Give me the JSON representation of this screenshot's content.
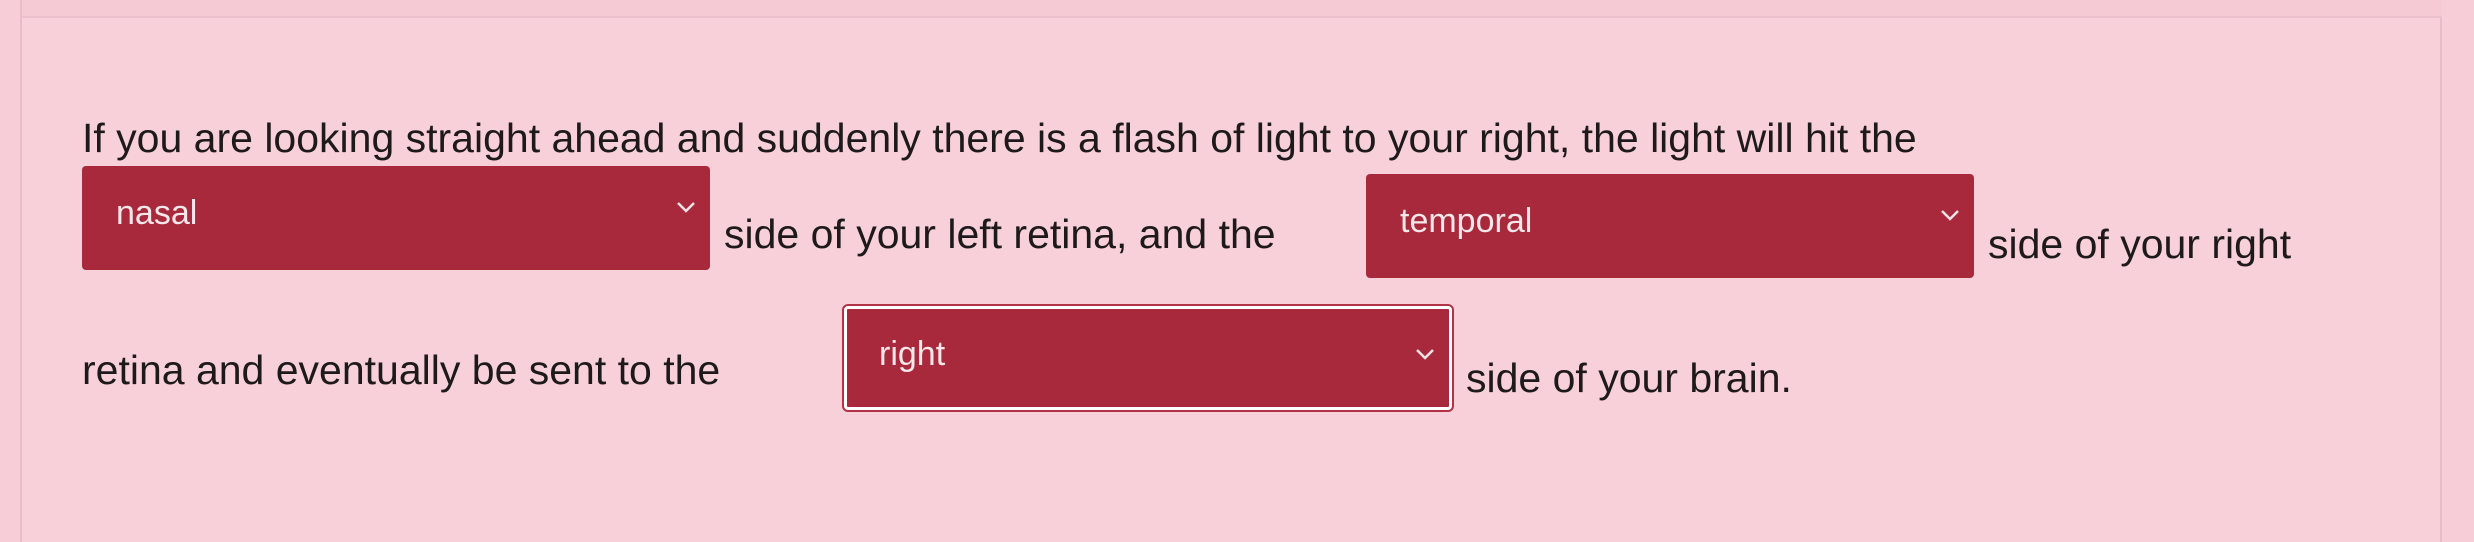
{
  "question": {
    "line1": "If you are looking straight ahead and suddenly there is a flash of light to your right, the light will hit the",
    "text_after_1": "side of your left retina, and the",
    "text_after_2": "side of your right",
    "text_line3_start": "retina and eventually be sent to the",
    "text_after_3": "side of your brain."
  },
  "dropdowns": [
    {
      "selected": "nasal",
      "icon": "chevron-down-icon"
    },
    {
      "selected": "temporal",
      "icon": "chevron-down-icon"
    },
    {
      "selected": "right",
      "icon": "chevron-down-icon"
    }
  ],
  "colors": {
    "background": "#f8d0da",
    "dropdown": "#a8293b",
    "dropdown_text": "#f7e6ea",
    "text": "#1e1a1c"
  }
}
